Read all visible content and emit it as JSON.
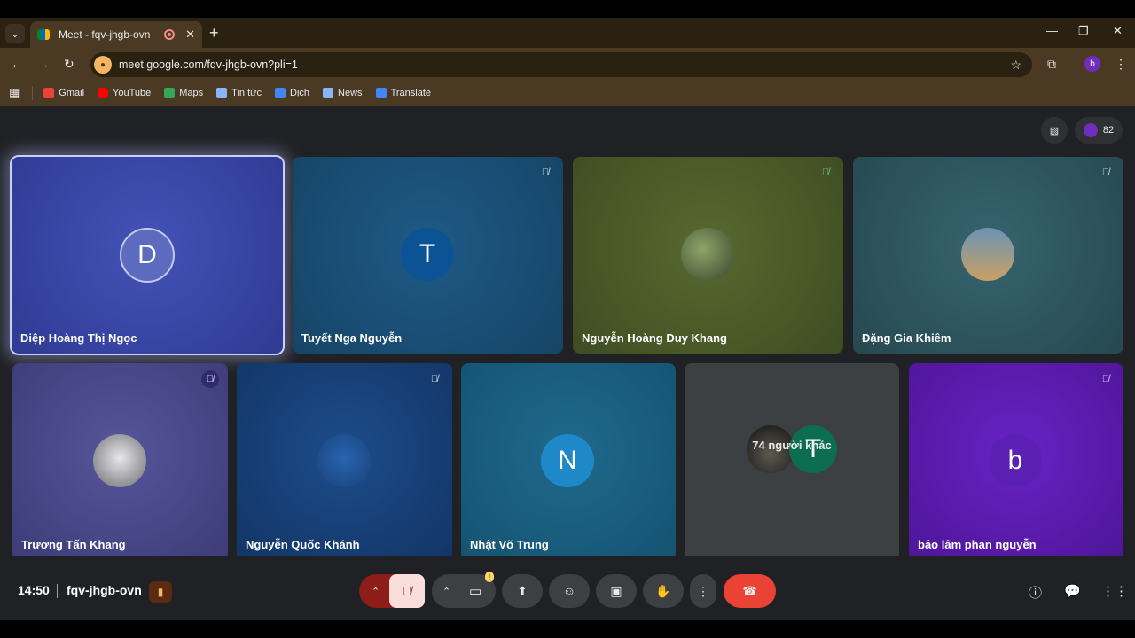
{
  "browser": {
    "tab_title": "Meet - fqv-jhgb-ovn",
    "url": "meet.google.com/fqv-jhgb-ovn?pli=1",
    "profile_initial": "b",
    "bookmarks": [
      "Gmail",
      "YouTube",
      "Maps",
      "Tin tức",
      "Dịch",
      "News",
      "Translate"
    ]
  },
  "meeting": {
    "participant_count": "82",
    "time": "14:50",
    "code": "fqv-jhgb-ovn"
  },
  "tiles": [
    {
      "name": "Diệp Hoàng Thị Ngọc",
      "initial": "D",
      "color": "#3c4aa8"
    },
    {
      "name": "Tuyết Nga Nguyễn",
      "initial": "T",
      "color": "#1d4f7a"
    },
    {
      "name": "Nguyễn Hoàng Duy Khang",
      "initial": "",
      "color": "#4c5d2a"
    },
    {
      "name": "Đặng Gia Khiêm",
      "initial": "",
      "color": "#2f5560"
    },
    {
      "name": "Trương Tấn Khang",
      "initial": "",
      "color": "#4b4a8a"
    },
    {
      "name": "Nguyễn Quốc Khánh",
      "initial": "",
      "color": "#173e77"
    },
    {
      "name": "Nhật Võ Trung",
      "initial": "N",
      "color": "#1a5b7a"
    },
    {
      "name": "",
      "initial": "T",
      "color": "#3c4043"
    },
    {
      "name": "bảo lâm phan nguyễn",
      "initial": "b",
      "color": "#5a1fb0"
    }
  ],
  "others_label": "74 người khác",
  "icons": {
    "mic_off": "mic-off-icon",
    "camera": "camera-icon",
    "present": "present-icon",
    "emoji": "emoji-icon",
    "captions": "captions-icon",
    "hand": "raise-hand-icon",
    "more": "more-options-icon",
    "hangup": "hangup-icon"
  },
  "colors": {
    "hangup": "#ea4335",
    "mic_off_bg": "#f9dedc",
    "mic_off_arrow": "#8c1d18"
  }
}
